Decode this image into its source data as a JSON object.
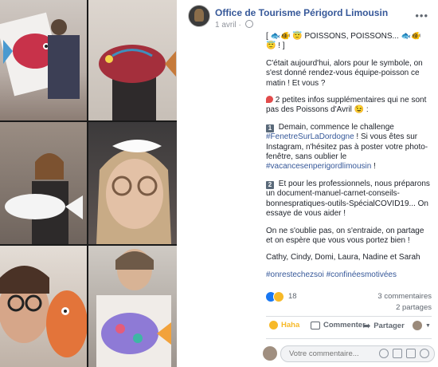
{
  "post": {
    "page_name": "Office de Tourisme Périgord Limousin",
    "date": "1 avril",
    "headline": "[ 🐟🐠 😇 POISSONS, POISSONS... 🐟🐠 😇 ! ]",
    "intro": "C'était aujourd'hui, alors pour le symbole, on s'est donné rendez-vous équipe-poisson ce matin ! Et vous ?",
    "info_intro": "2 petites infos supplémentaires qui ne sont pas des Poissons d'Avril 😉 :",
    "item1_number": "1",
    "item1_text_a": "Demain, commence le challenge",
    "item1_tag": "#FenetreSurLaDordogne",
    "item1_text_b": "! Si vous êtes sur Instagram, n'hésitez pas à poster votre photo-fenêtre, sans oublier le",
    "item1_tag2": "#vacancesenperigordlimousin",
    "item1_text_c": "!",
    "item2_number": "2",
    "item2_text": "Et pour les professionnels, nous préparons un document-manuel-carnet-conseils-bonnespratiques-outils-SpécialCOVID19... On essaye de vous aider !",
    "closing": "On ne s'oublie pas, on s'entraide, on partage et on espère que vous vous portez bien !",
    "signature": "Cathy, Cindy, Domi, Laura, Nadine et Sarah",
    "hashtags": "#onrestechezsoi #confinéesmotivées"
  },
  "stats": {
    "reaction_count": "18",
    "comments": "3 commentaires",
    "shares": "2 partages"
  },
  "actions": {
    "haha": "Haha",
    "comment": "Commenter",
    "share": "Partager"
  },
  "comment_box": {
    "placeholder": "Votre commentaire..."
  },
  "icons": {
    "more": "more-icon",
    "globe": "globe-icon",
    "like": "like-reaction-icon",
    "haha": "haha-reaction-icon",
    "comment": "comment-icon",
    "share": "share-icon"
  },
  "colors": {
    "link": "#365899",
    "haha": "#f7b928",
    "like": "#1877f2"
  }
}
